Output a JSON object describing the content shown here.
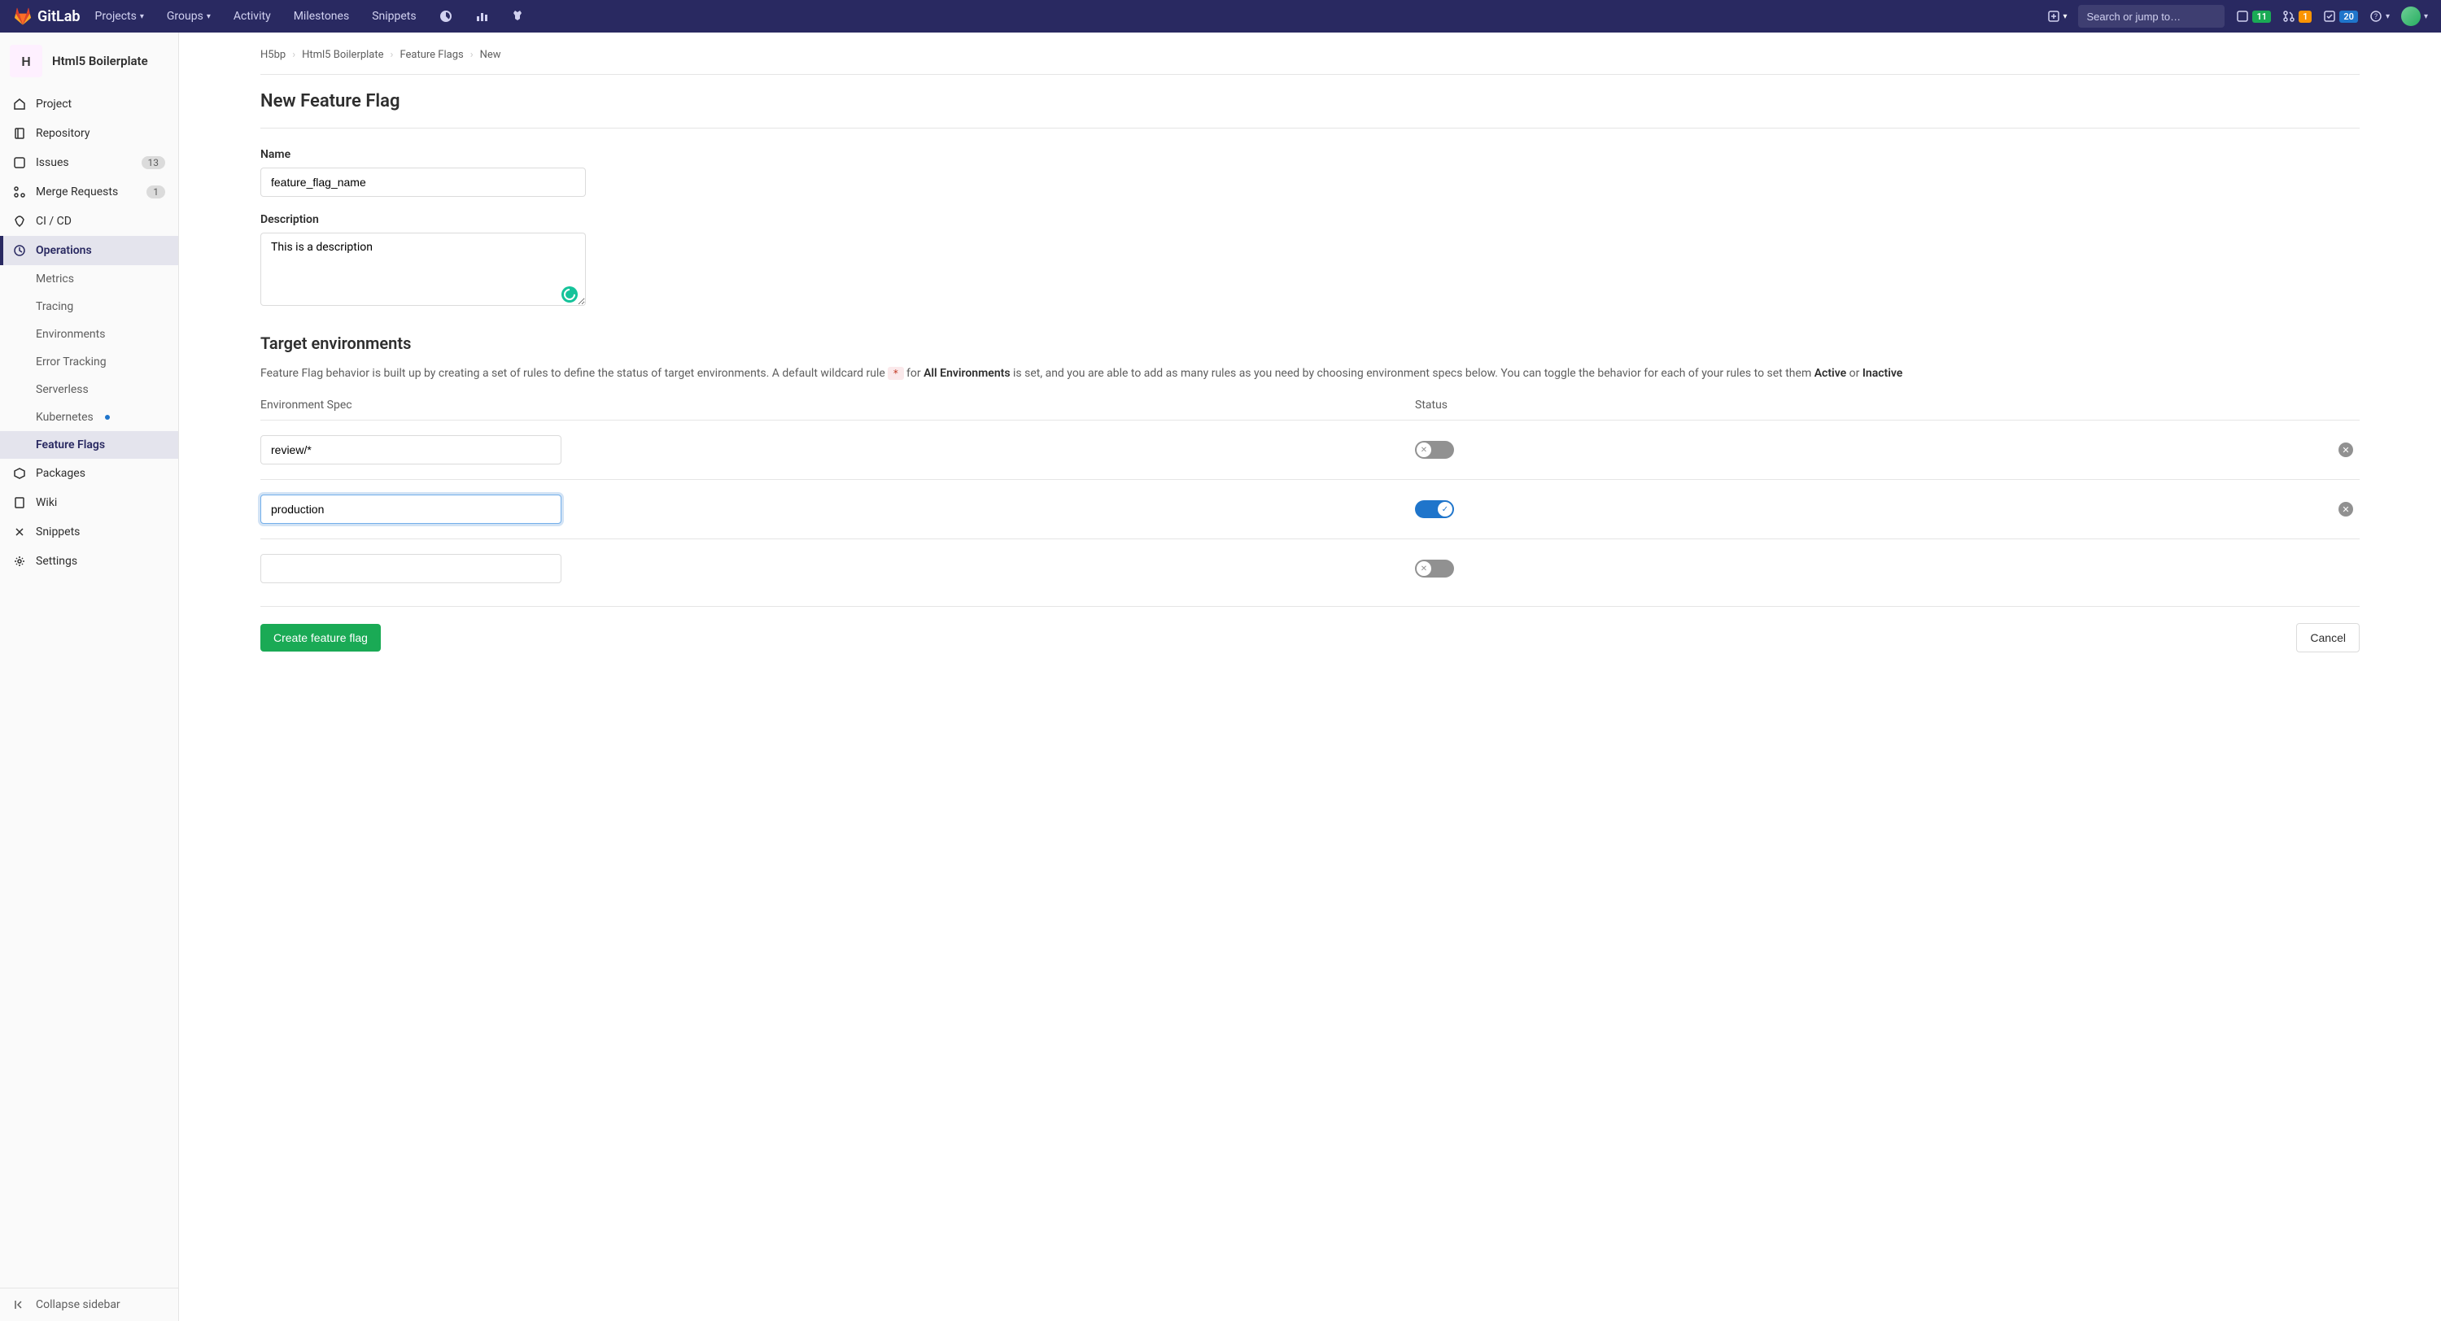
{
  "header": {
    "brand": "GitLab",
    "nav": [
      "Projects",
      "Groups",
      "Activity",
      "Milestones",
      "Snippets"
    ],
    "search_placeholder": "Search or jump to…",
    "counts": {
      "issues": "11",
      "merge_requests": "1",
      "todos": "20"
    }
  },
  "project": {
    "initial": "H",
    "name": "Html5 Boilerplate"
  },
  "sidebar": {
    "items": [
      {
        "label": "Project"
      },
      {
        "label": "Repository"
      },
      {
        "label": "Issues",
        "badge": "13"
      },
      {
        "label": "Merge Requests",
        "badge": "1"
      },
      {
        "label": "CI / CD"
      },
      {
        "label": "Operations"
      },
      {
        "label": "Packages"
      },
      {
        "label": "Wiki"
      },
      {
        "label": "Snippets"
      },
      {
        "label": "Settings"
      }
    ],
    "ops_sub": [
      "Metrics",
      "Tracing",
      "Environments",
      "Error Tracking",
      "Serverless",
      "Kubernetes",
      "Feature Flags"
    ],
    "collapse": "Collapse sidebar"
  },
  "breadcrumb": [
    "H5bp",
    "Html5 Boilerplate",
    "Feature Flags",
    "New"
  ],
  "page": {
    "title": "New Feature Flag",
    "name_label": "Name",
    "name_value": "feature_flag_name",
    "desc_label": "Description",
    "desc_value": "This is a description",
    "target_title": "Target environments",
    "target_desc_1": "Feature Flag behavior is built up by creating a set of rules to define the status of target environments. A default wildcard rule ",
    "target_desc_for": " for ",
    "target_desc_all": "All Environments",
    "target_desc_2": " is set, and you are able to add as many rules as you need by choosing environment specs below. You can toggle the behavior for each of your rules to set them ",
    "active": "Active",
    "or": " or ",
    "inactive": "Inactive",
    "wildcard": "*",
    "col_spec": "Environment Spec",
    "col_status": "Status",
    "rows": [
      {
        "value": "review/*",
        "on": false,
        "removable": true
      },
      {
        "value": "production",
        "on": true,
        "removable": true,
        "focused": true
      },
      {
        "value": "",
        "on": false,
        "removable": false
      }
    ],
    "submit": "Create feature flag",
    "cancel": "Cancel"
  }
}
